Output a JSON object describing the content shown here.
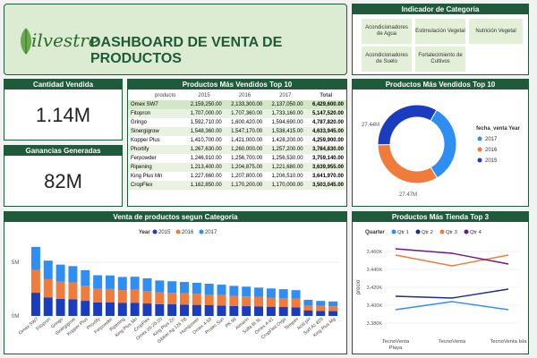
{
  "title_card": {
    "logo_text": "ilvestre",
    "title": "DASHBOARD DE VENTA DE PRODUCTOS"
  },
  "indicator": {
    "header": "Indicador de Categoria",
    "items": [
      "Acondicionadores de Agua",
      "Estimulación Vegetal",
      "Nutrición Vegetal",
      "Acondicionadores de Suelo",
      "Fortalecimiento de Cultivos"
    ]
  },
  "kpi_qty": {
    "header": "Cantidad Vendida",
    "value": "1.14M"
  },
  "kpi_profit": {
    "header": "Ganancias Generadas",
    "value": "82M"
  },
  "top10_table": {
    "header": "Productos Más Vendidos Top 10",
    "columns": [
      "producto",
      "2015",
      "2016",
      "2017",
      "Total"
    ],
    "rows": [
      [
        "Omex SW7",
        "2,159,250.00",
        "2,133,300.00",
        "2,137,050.00",
        "6,429,600.00"
      ],
      [
        "Fitopron",
        "1,707,000.00",
        "1,707,360.00",
        "1,733,160.00",
        "5,147,520.00"
      ],
      [
        "Gringo",
        "1,592,710.00",
        "1,600,420.00",
        "1,594,690.00",
        "4,787,820.00"
      ],
      [
        "Sinergigrow",
        "1,548,360.00",
        "1,547,170.00",
        "1,538,415.00",
        "4,633,945.00"
      ],
      [
        "Kopper Plus",
        "1,410,700.00",
        "1,421,000.00",
        "1,428,200.00",
        "4,259,900.00"
      ],
      [
        "Phortify",
        "1,267,630.00",
        "1,260,000.00",
        "1,257,200.00",
        "3,784,830.00"
      ],
      [
        "Ferpowder",
        "1,246,910.00",
        "1,256,700.00",
        "1,256,530.00",
        "3,759,140.00"
      ],
      [
        "Ripening",
        "1,213,400.00",
        "1,204,875.00",
        "1,221,680.00",
        "3,639,955.00"
      ],
      [
        "King Plus Mn",
        "1,227,660.00",
        "1,207,800.00",
        "1,206,510.00",
        "3,641,970.00"
      ],
      [
        "CropFlex",
        "1,162,850.00",
        "1,170,200.00",
        "1,170,000.00",
        "3,503,045.00"
      ]
    ]
  },
  "donut": {
    "header": "Productos Más Vendidos Top 10",
    "legend_title": "fecha_venta Year",
    "labels": [
      "27.44M",
      "27.47M"
    ],
    "colors": {
      "2017": "#2f8ef3",
      "2016": "#ef7b3c",
      "2015": "#1a3cbf"
    },
    "chart_data": {
      "type": "pie",
      "categories": [
        "2017",
        "2016",
        "2015"
      ],
      "values": [
        27.44,
        27.47,
        27.7
      ]
    }
  },
  "bar_chart": {
    "header": "Venta de productos segun Categoría",
    "legend_title": "Year",
    "legend": [
      "2015",
      "2016",
      "2017"
    ],
    "y_ticks": [
      "5M",
      "0M"
    ],
    "chart_data": {
      "type": "bar",
      "stacked": true,
      "categories": [
        "Omex SW7",
        "Fitopron",
        "Gringo",
        "Sinergigrow",
        "Kopper Plus",
        "Phortify",
        "Ferpowder",
        "Ripening",
        "King Plus Mn",
        "CropFlex",
        "Omex 20-20-20",
        "King Plus Zn",
        "Gibber Ag 126 TB",
        "Humipower",
        "Omex 4-50",
        "Protec Sun",
        "PK 98",
        "Almarin",
        "Sulfa Bi 3L",
        "Omex 4-41",
        "CropFlex Orga",
        "Tempes",
        "Acid pH",
        "Surf Ac 820",
        "King Plus Mg"
      ],
      "series": [
        {
          "name": "2015",
          "values": [
            2.16,
            1.71,
            1.59,
            1.55,
            1.41,
            1.27,
            1.25,
            1.21,
            1.23,
            1.16,
            1.1,
            1.08,
            1.06,
            1.03,
            1.0,
            0.97,
            0.93,
            0.91,
            0.88,
            0.86,
            0.83,
            0.8,
            0.5,
            0.47,
            0.45
          ]
        },
        {
          "name": "2016",
          "values": [
            2.13,
            1.71,
            1.6,
            1.55,
            1.42,
            1.26,
            1.26,
            1.2,
            1.21,
            1.17,
            1.1,
            1.08,
            1.05,
            1.03,
            1.0,
            0.97,
            0.94,
            0.91,
            0.88,
            0.85,
            0.83,
            0.8,
            0.5,
            0.47,
            0.45
          ]
        },
        {
          "name": "2017",
          "values": [
            2.14,
            1.73,
            1.59,
            1.54,
            1.43,
            1.26,
            1.26,
            1.22,
            1.21,
            1.17,
            1.1,
            1.07,
            1.05,
            1.03,
            1.0,
            0.97,
            0.93,
            0.91,
            0.88,
            0.85,
            0.83,
            0.8,
            0.5,
            0.46,
            0.45
          ]
        }
      ],
      "ylim": [
        0,
        7
      ]
    }
  },
  "line_chart": {
    "header": "Productos Más Tienda Top 3",
    "legend_title": "Quarter",
    "legend": [
      "Qtr 1",
      "Qtr 2",
      "Qtr 3",
      "Qtr 4"
    ],
    "ylabel": "precio",
    "y_ticks": [
      "3.460K",
      "3.440K",
      "3.420K",
      "3.400K",
      "3.380K"
    ],
    "x_labels": [
      "TecnoVenta Playa",
      "TecnoVenta",
      "TecnoVenta Isla"
    ],
    "chart_data": {
      "type": "line",
      "x": [
        "TecnoVenta Playa",
        "TecnoVenta",
        "TecnoVenta Isla"
      ],
      "ylim": [
        3370,
        3470
      ],
      "series": [
        {
          "name": "Qtr 1",
          "values": [
            3395,
            3404,
            3395
          ]
        },
        {
          "name": "Qtr 2",
          "values": [
            3410,
            3408,
            3418
          ]
        },
        {
          "name": "Qtr 3",
          "values": [
            3456,
            3444,
            3456
          ]
        },
        {
          "name": "Qtr 4",
          "values": [
            3463,
            3458,
            3446
          ]
        }
      ]
    },
    "colors": {
      "Qtr 1": "#2f8ef3",
      "Qtr 2": "#1a2e8a",
      "Qtr 3": "#ef7b3c",
      "Qtr 4": "#6a1a8a"
    }
  }
}
